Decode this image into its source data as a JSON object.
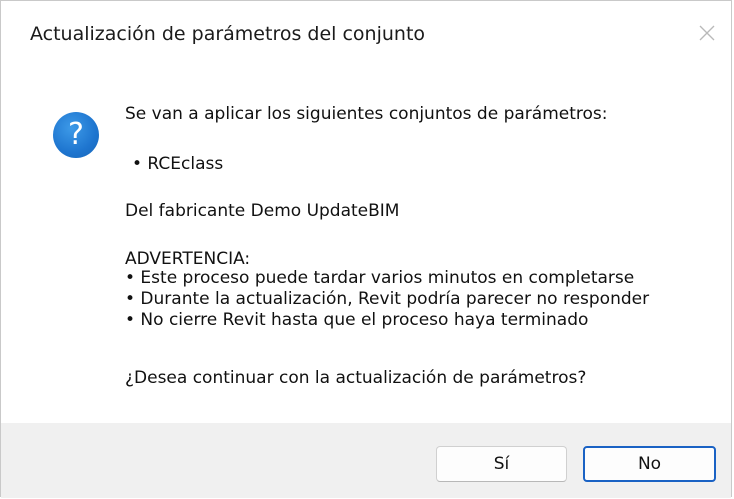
{
  "dialog": {
    "title": "Actualización de parámetros del conjunto",
    "close_icon": "close-icon",
    "question_icon": "question-icon",
    "question_icon_glyph": "?",
    "accent_color": "#1e75cf"
  },
  "message": {
    "intro": "Se van a aplicar los siguientes conjuntos de parámetros:",
    "item": "• RCEclass",
    "manufacturer": "Del fabricante Demo UpdateBIM",
    "warning_title": "ADVERTENCIA:",
    "warnings": [
      "• Este proceso puede tardar varios minutos en completarse",
      "• Durante la actualización, Revit podría parecer no responder",
      "• No cierre Revit hasta que el proceso haya terminado"
    ],
    "question": "¿Desea continuar con la actualización de parámetros?"
  },
  "buttons": {
    "yes": "Sí",
    "no": "No"
  }
}
